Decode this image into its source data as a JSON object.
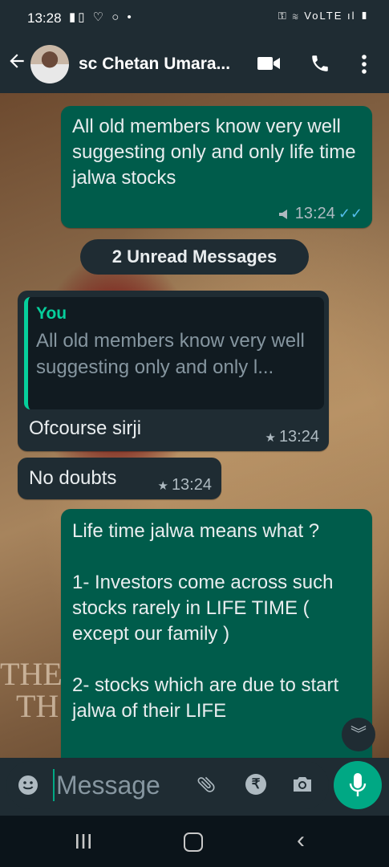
{
  "status_bar": {
    "time": "13:28",
    "left_icons": "▮▯ ♡ ○ •",
    "right_icons": "⚿ ≋ VoLTE ıl ▮"
  },
  "header": {
    "contact_name": "sc Chetan Umara..."
  },
  "messages": [
    {
      "direction": "out",
      "text": "All old members know very well\nsuggesting only and only life time jalwa stocks",
      "time": "13:24",
      "broadcast": true,
      "status": "read"
    },
    {
      "direction": "in",
      "quoted_name": "You",
      "quoted_text": "All old members know very well\nsuggesting only and only l...",
      "text": "Ofcourse sirji",
      "time": "13:24",
      "starred": true
    },
    {
      "direction": "in",
      "text": "No doubts",
      "time": "13:24",
      "starred": true
    },
    {
      "direction": "out",
      "text": "Life time jalwa means what ?\n\n1- Investors come across such stocks rarely in LIFE TIME ( except our family )\n\n2- stocks which are due to start jalwa of their LIFE"
    }
  ],
  "unread_label": "2 Unread Messages",
  "wallpaper_text": [
    "THE",
    "TH"
  ],
  "input": {
    "placeholder": "Message"
  },
  "colors": {
    "outgoing_bubble": "#005c4b",
    "incoming_bubble": "#1f2c33",
    "accent": "#00a884",
    "read_ticks": "#53bdeb"
  },
  "icons": {
    "header": [
      "back-arrow-icon",
      "video-call-icon",
      "phone-icon",
      "more-vert-icon"
    ],
    "input": [
      "emoji-icon",
      "attach-icon",
      "rupee-payment-icon",
      "camera-icon",
      "mic-icon"
    ]
  }
}
